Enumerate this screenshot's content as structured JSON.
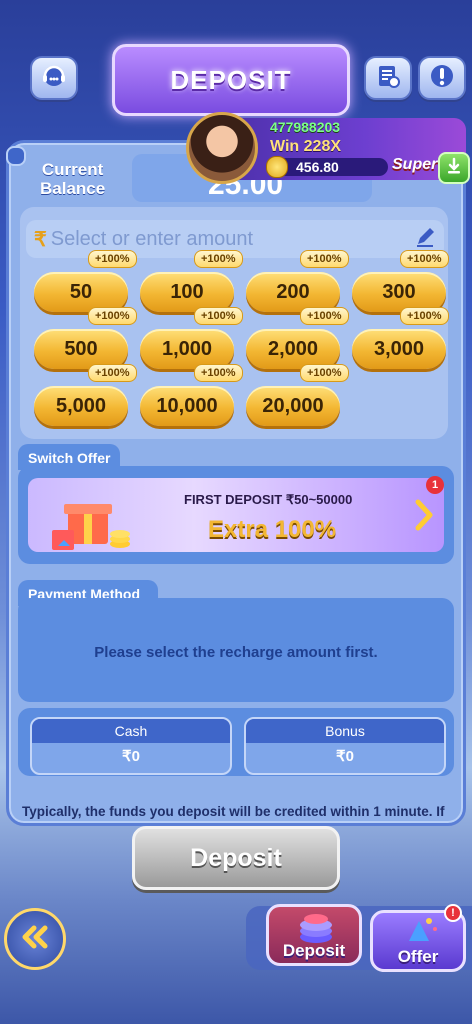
{
  "header": {
    "title": "DEPOSIT"
  },
  "profile": {
    "user_id": "477988203",
    "win_label": "Win",
    "win_multiplier": "228X",
    "coins": "456.80",
    "game_label": "Super"
  },
  "balance": {
    "label_line1": "Current",
    "label_line2": "Balance",
    "value": "25.00"
  },
  "amount_input": {
    "currency_symbol": "₹",
    "placeholder": "Select or enter amount"
  },
  "amount_chips": [
    {
      "value": "50",
      "bonus": "+100%"
    },
    {
      "value": "100",
      "bonus": "+100%"
    },
    {
      "value": "200",
      "bonus": "+100%"
    },
    {
      "value": "300",
      "bonus": "+100%"
    },
    {
      "value": "500",
      "bonus": "+100%"
    },
    {
      "value": "1,000",
      "bonus": "+100%"
    },
    {
      "value": "2,000",
      "bonus": "+100%"
    },
    {
      "value": "3,000",
      "bonus": "+100%"
    },
    {
      "value": "5,000",
      "bonus": "+100%"
    },
    {
      "value": "10,000",
      "bonus": "+100%"
    },
    {
      "value": "20,000",
      "bonus": "+100%"
    }
  ],
  "switch_offer": {
    "tab_label": "Switch Offer",
    "offer_title": "FIRST DEPOSIT ₹50~50000",
    "offer_highlight": "Extra 100%",
    "notification_count": "1"
  },
  "payment_method": {
    "tab_label": "Payment Method",
    "message": "Please select the recharge amount first."
  },
  "wallets": {
    "cash_label": "Cash",
    "cash_value": "₹0",
    "bonus_label": "Bonus",
    "bonus_value": "₹0"
  },
  "notice": "Typically, the funds you deposit will be credited within 1 minute. If",
  "primary_button": "Deposit",
  "bottom_nav": {
    "deposit_label": "Deposit",
    "offer_label": "Offer"
  },
  "colors": {
    "accent_gold": "#f3b733",
    "panel_blue": "#5c8de0",
    "title_purple": "#7a4ce0",
    "win_green": "#7dff8a"
  },
  "icons": [
    "support-icon",
    "record-icon",
    "info-icon",
    "back-arrows-icon",
    "download-icon",
    "pencil-icon",
    "chevron-right-icon"
  ]
}
